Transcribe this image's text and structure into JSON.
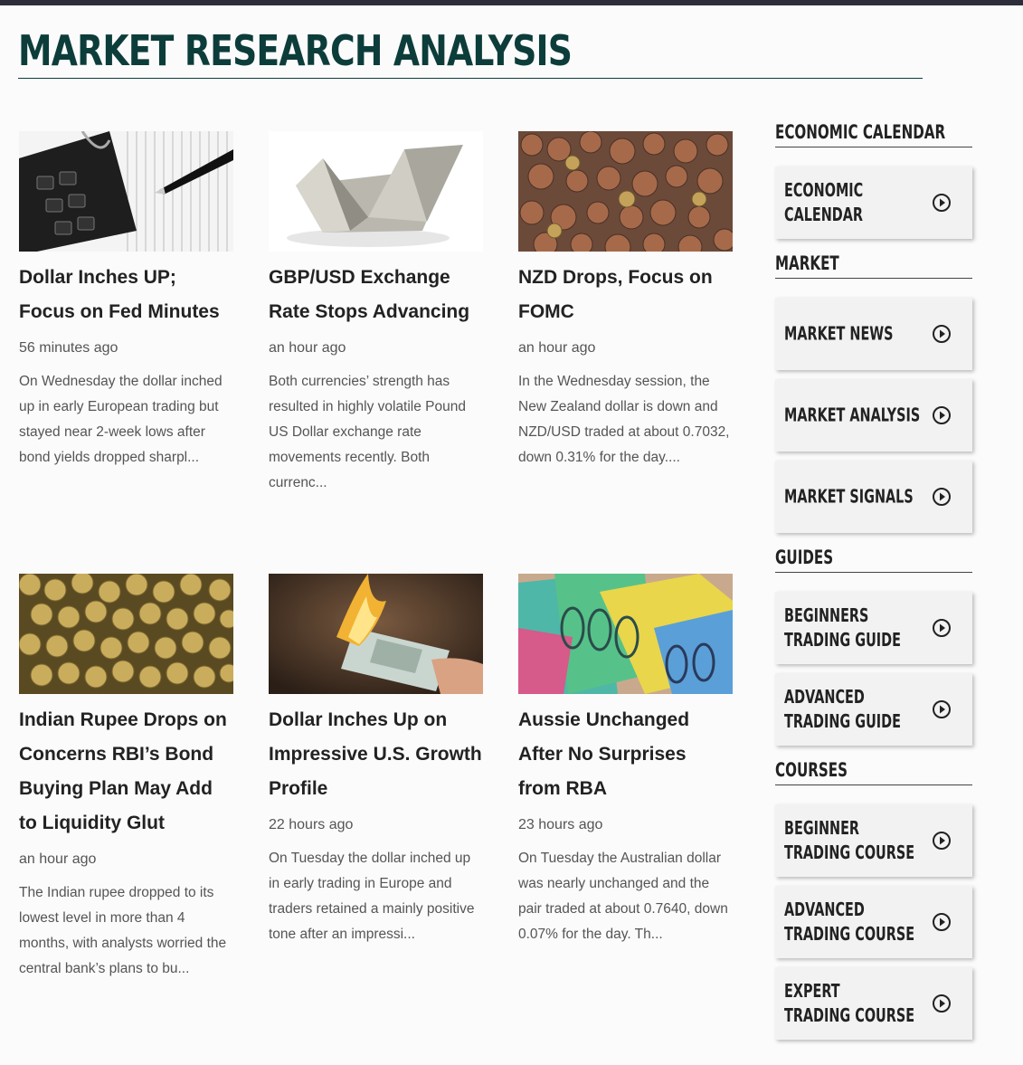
{
  "page": {
    "title": "MARKET RESEARCH ANALYSIS"
  },
  "articles": [
    {
      "title": "Dollar Inches UP; Focus on Fed Minutes",
      "time": "56 minutes ago",
      "excerpt": "On Wednesday the dollar inched up in early European trading but stayed near 2-week lows after bond yields dropped sharpl..."
    },
    {
      "title": "GBP/USD Exchange Rate Stops Advancing",
      "time": "an hour ago",
      "excerpt": "Both currencies’ strength has resulted in highly volatile Pound US Dollar exchange rate movements recently. Both currenc..."
    },
    {
      "title": "NZD Drops, Focus on FOMC",
      "time": "an hour ago",
      "excerpt": "In the Wednesday session, the New Zealand dollar is down and NZD/USD traded at about 0.7032, down 0.31% for the day...."
    },
    {
      "title": "Indian Rupee Drops on Concerns RBI’s Bond Buying Plan May Add to Liquidity Glut",
      "time": "an hour ago",
      "excerpt": "The Indian rupee dropped to its lowest level in more than 4 months, with analysts worried the central bank’s plans to bu..."
    },
    {
      "title": "Dollar Inches Up on Impressive U.S. Growth Profile",
      "time": "22 hours ago",
      "excerpt": "On Tuesday the dollar inched up in early trading in Europe and traders retained a mainly positive tone after an impressi..."
    },
    {
      "title": "Aussie Unchanged After No Surprises from RBA",
      "time": "23 hours ago",
      "excerpt": "On Tuesday the Australian dollar was nearly unchanged and the pair traded at about 0.7640, down 0.07% for the day. Th..."
    }
  ],
  "sidebar": {
    "economic_heading": "ECONOMIC CALENDAR",
    "economic_calendar": "ECONOMIC\nCALENDAR",
    "market_heading": "MARKET",
    "market_news": "MARKET NEWS",
    "market_analysis": "MARKET ANALYSIS",
    "market_signals": "MARKET SIGNALS",
    "guides_heading": "GUIDES",
    "beginners_guide": "BEGINNERS\nTRADING GUIDE",
    "advanced_guide": "ADVANCED\nTRADING GUIDE",
    "courses_heading": "COURSES",
    "beginner_course": "BEGINNER\nTRADING COURSE",
    "advanced_course": "ADVANCED\nTRADING COURSE",
    "expert_course": "EXPERT\nTRADING COURSE"
  }
}
